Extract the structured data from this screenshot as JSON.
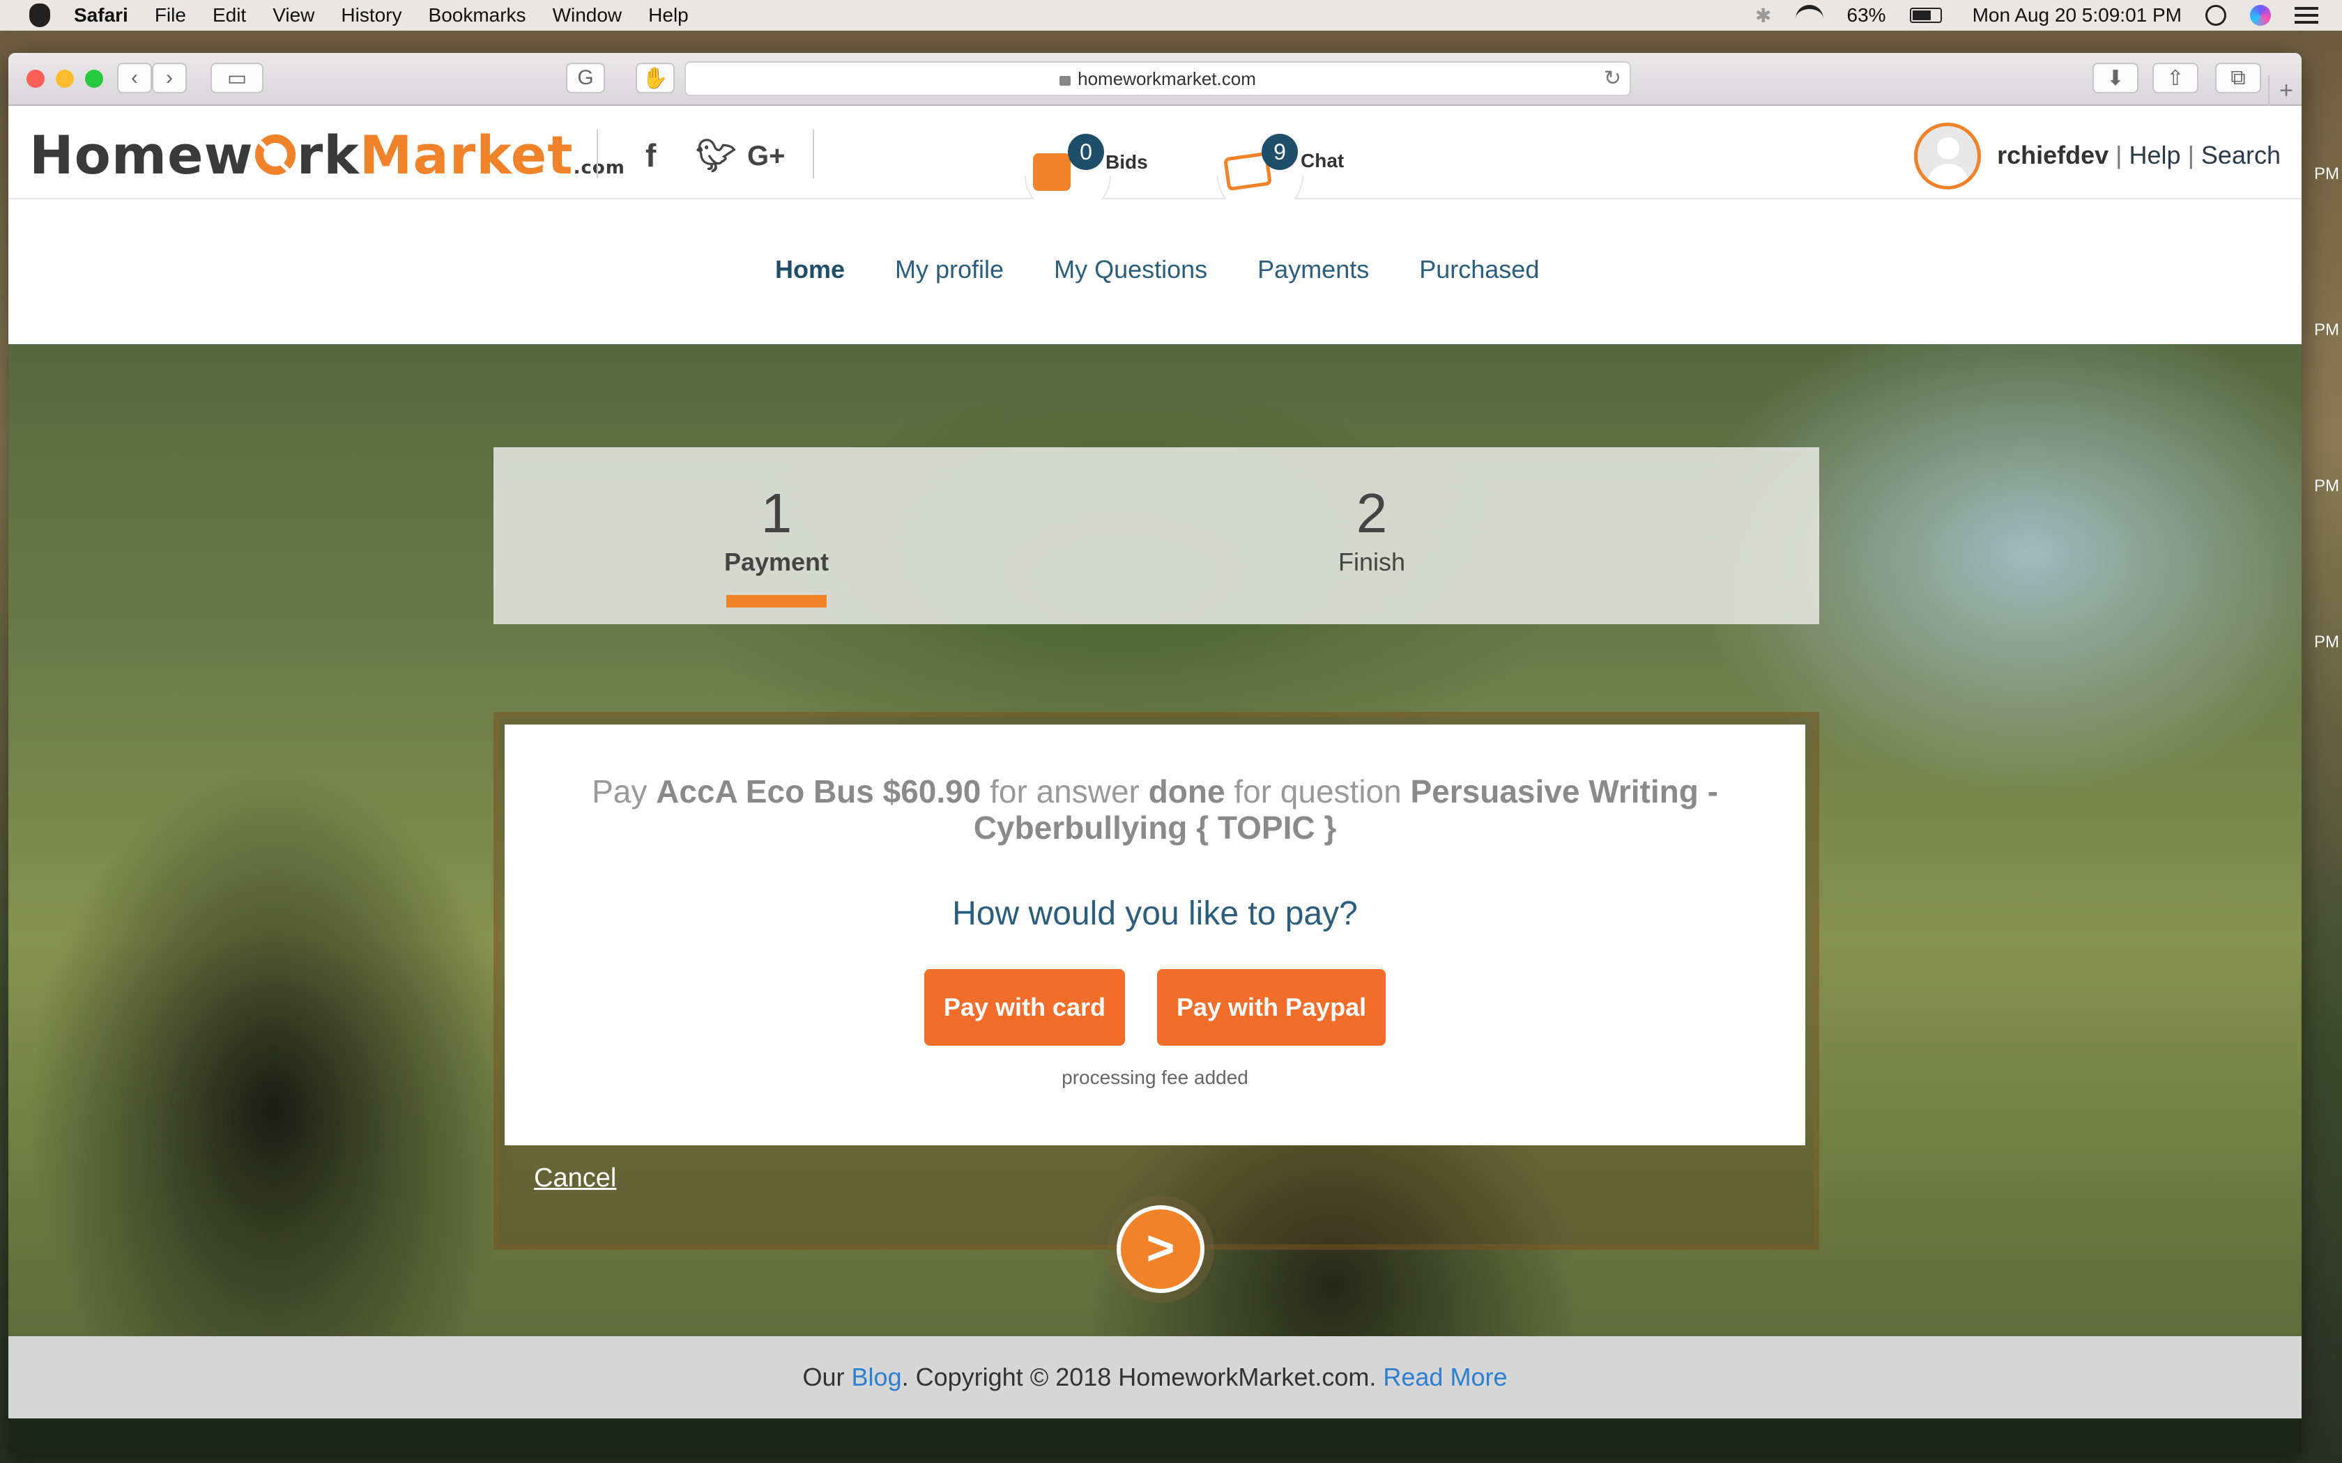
{
  "menubar": {
    "app": "Safari",
    "items": [
      "File",
      "Edit",
      "View",
      "History",
      "Bookmarks",
      "Window",
      "Help"
    ],
    "battery": "63%",
    "clock": "Mon Aug 20  5:09:01 PM"
  },
  "browser": {
    "url": "homeworkmarket.com"
  },
  "header": {
    "logo_part1": "Homew",
    "logo_part2": "rk",
    "logo_part3": "Market",
    "logo_com": ".com",
    "bids_count": "0",
    "bids_label": "Bids",
    "chat_count": "9",
    "chat_label": "Chat",
    "username": "rchiefdev",
    "help": "Help",
    "search": "Search"
  },
  "nav": {
    "items": [
      "Home",
      "My profile",
      "My Questions",
      "Payments",
      "Purchased"
    ]
  },
  "stepper": {
    "steps": [
      {
        "num": "1",
        "label": "Payment"
      },
      {
        "num": "2",
        "label": "Finish"
      }
    ]
  },
  "payment": {
    "pay_word": "Pay",
    "course": "AccA Eco Bus",
    "amount": "$60.90",
    "for_answer": "for answer",
    "answer": "done",
    "for_question": "for question",
    "question_title": "Persuasive Writing - Cyberbullying { TOPIC }",
    "prompt": "How would you like to pay?",
    "card_button": "Pay with card",
    "paypal_button": "Pay with Paypal",
    "fee_note": "processing fee added",
    "cancel": "Cancel",
    "next": ">"
  },
  "footer": {
    "our": "Our",
    "blog": "Blog",
    "copyright": ". Copyright © 2018 HomeworkMarket.com.",
    "read_more": "Read More"
  },
  "desktop": {
    "pm": "PM"
  },
  "colors": {
    "accent": "#f0832a",
    "button": "#f26c2a",
    "navy": "#1f4e6b",
    "link": "#2c7fd1"
  }
}
